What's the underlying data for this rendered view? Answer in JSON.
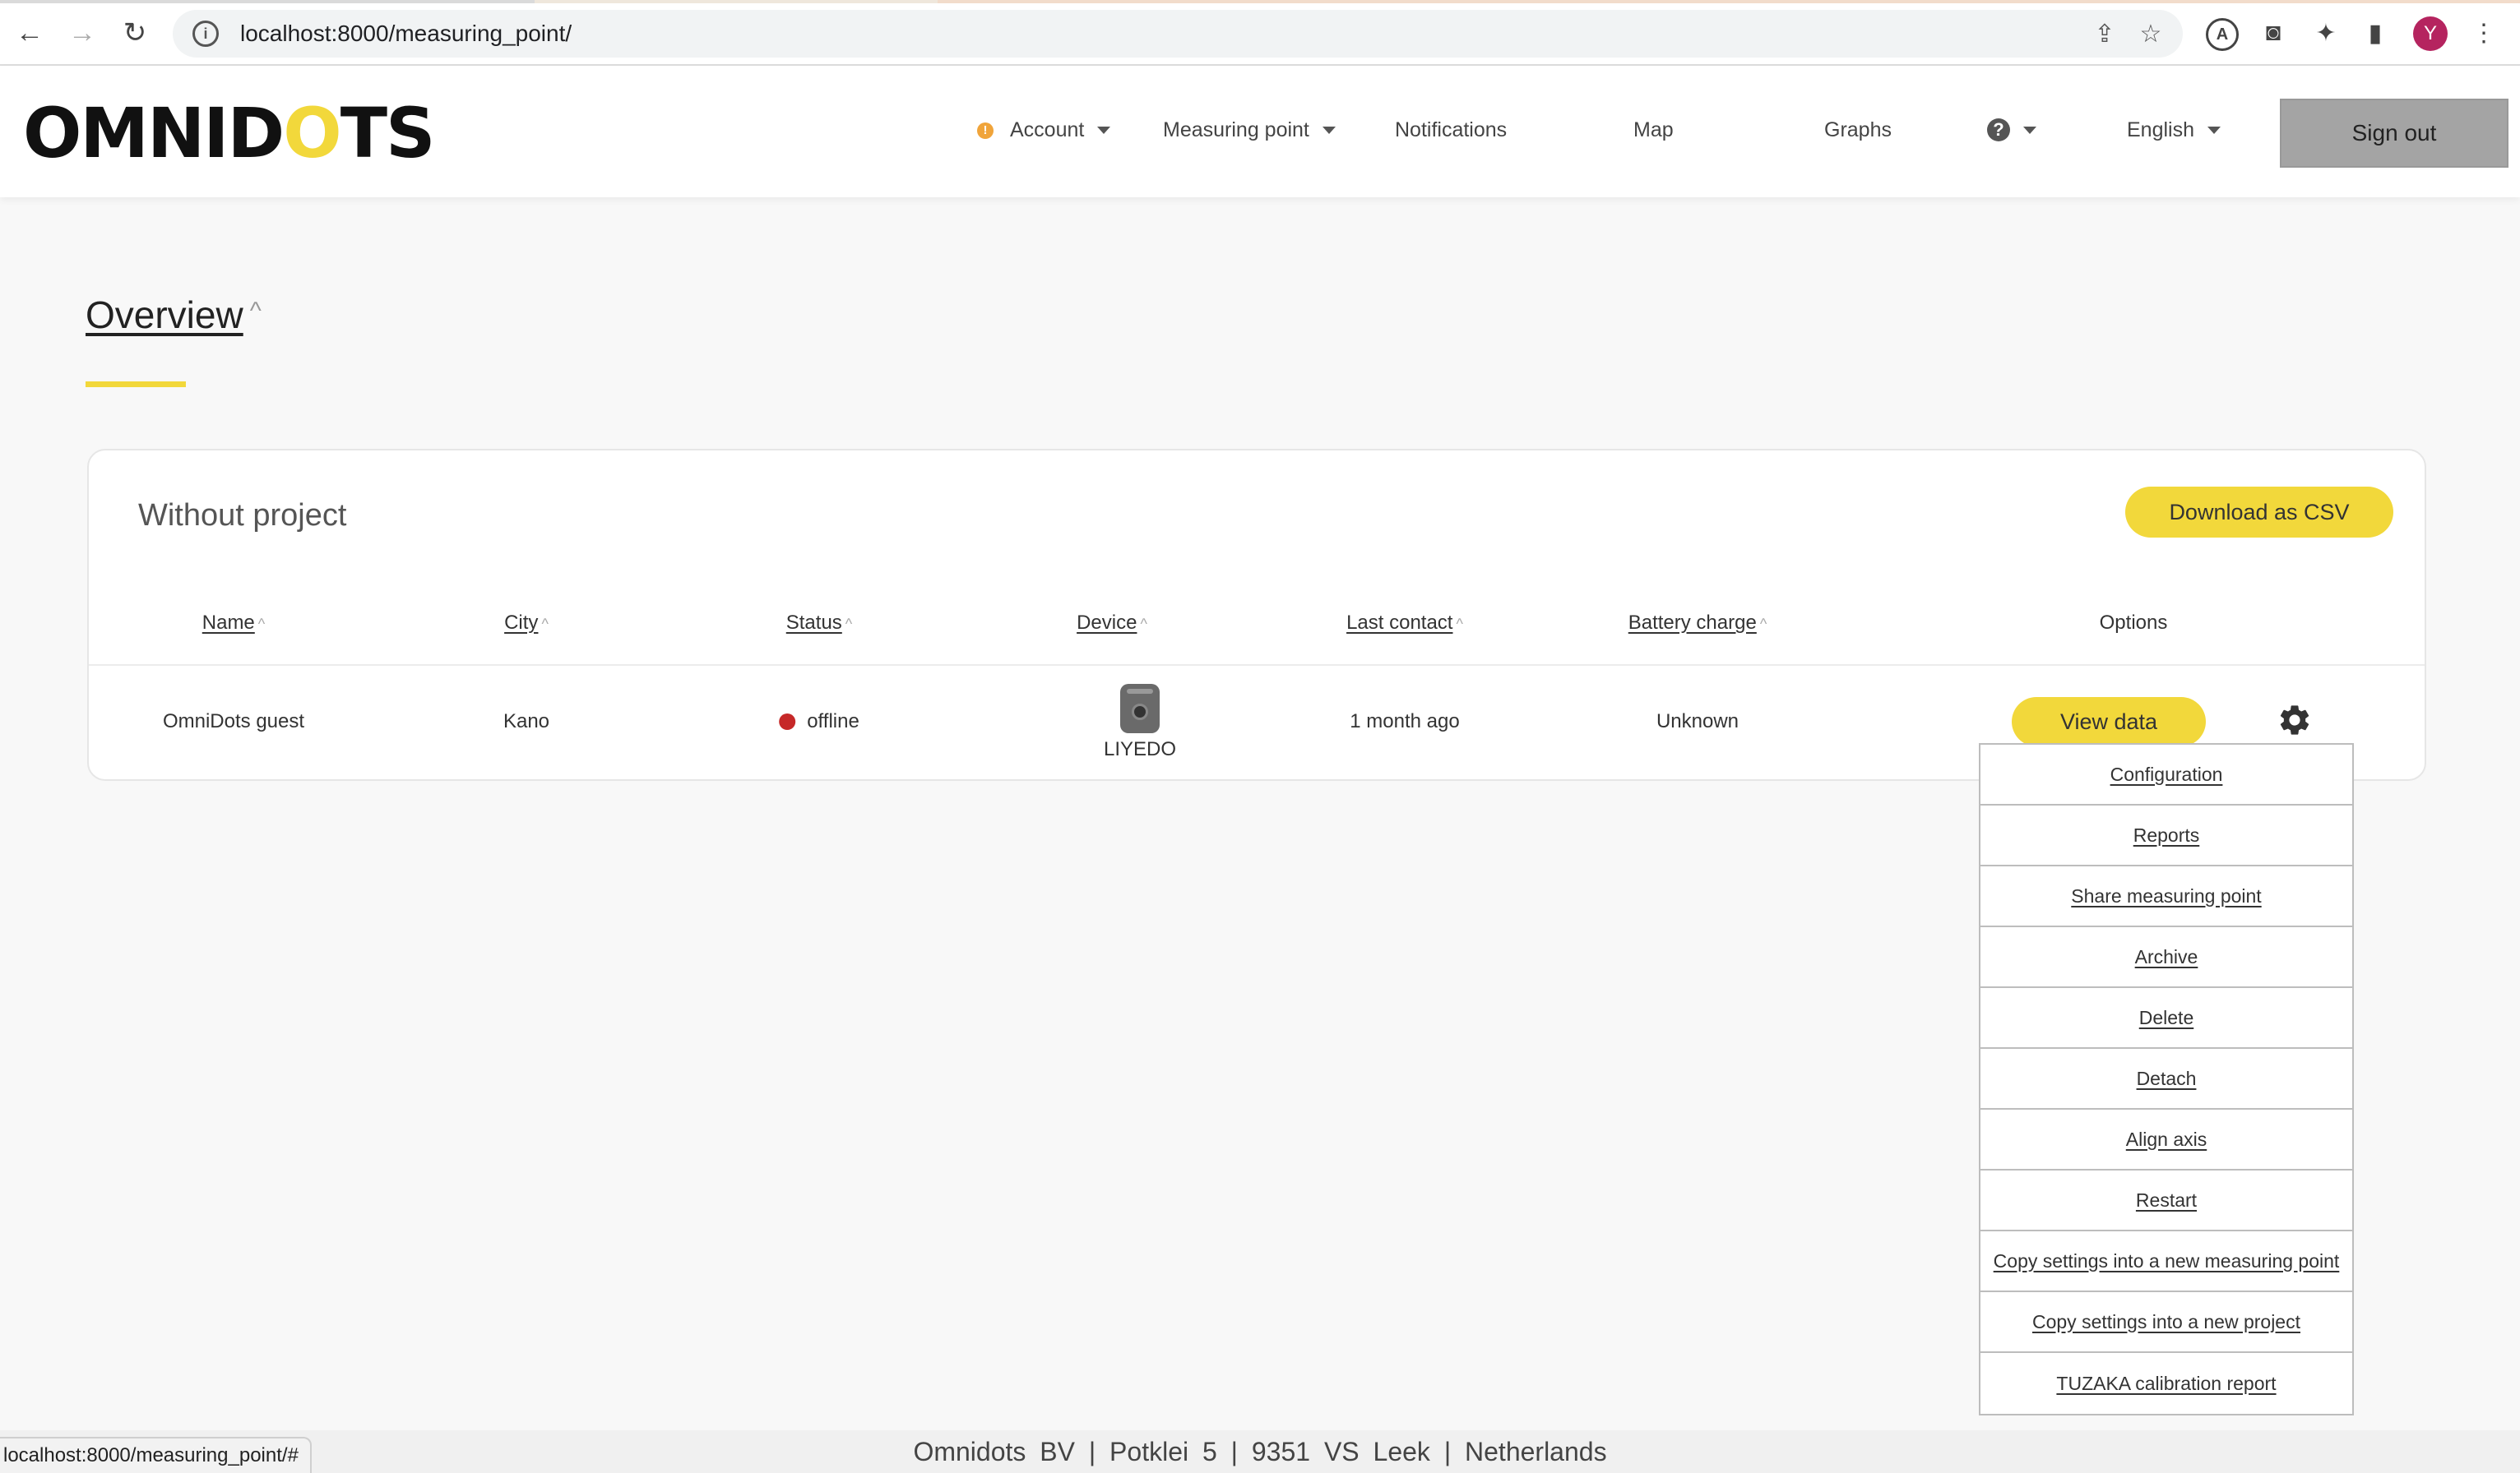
{
  "browser": {
    "url": "localhost:8000/measuring_point/",
    "avatar_letter": "Y",
    "status_url": "localhost:8000/measuring_point/#"
  },
  "header": {
    "logo": "OMNIDOTS",
    "nav": {
      "account": "Account",
      "measuring_point": "Measuring point",
      "notifications": "Notifications",
      "map": "Map",
      "graphs": "Graphs",
      "language": "English"
    },
    "sign_out": "Sign out"
  },
  "page": {
    "title": "Overview",
    "sort_glyph": "^"
  },
  "card": {
    "title": "Without project",
    "download_csv": "Download as CSV",
    "columns": {
      "name": "Name",
      "city": "City",
      "status": "Status",
      "device": "Device",
      "last_contact": "Last contact",
      "battery": "Battery charge",
      "options": "Options"
    },
    "row": {
      "name": "OmniDots guest",
      "city": "Kano",
      "status": "offline",
      "device": "LIYEDO",
      "last_contact": "1 month ago",
      "battery": "Unknown",
      "view_data": "View data"
    }
  },
  "menu": [
    "Configuration",
    "Reports",
    "Share measuring point",
    "Archive",
    "Delete",
    "Detach",
    "Align axis",
    "Restart",
    "Copy settings into a new measuring point",
    "Copy settings into a new project",
    "TUZAKA calibration report"
  ],
  "footer": "Omnidots BV | Potklei 5 | 9351 VS Leek | Netherlands",
  "colors": {
    "accent": "#f2d83b",
    "status_offline": "#c62828",
    "alert": "#f0a43a"
  }
}
